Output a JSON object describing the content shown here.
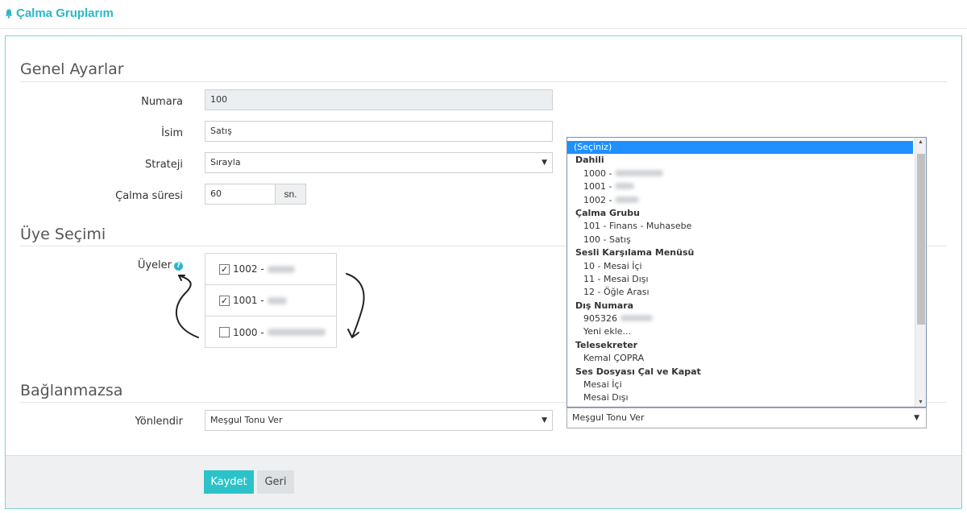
{
  "page": {
    "title": "Çalma Gruplarım"
  },
  "sections": {
    "general": "Genel Ayarlar",
    "members": "Üye Seçimi",
    "no_answer": "Bağlanmazsa"
  },
  "form": {
    "number_label": "Numara",
    "number_value": "100",
    "name_label": "İsim",
    "name_value": "Satış",
    "strategy_label": "Strateji",
    "strategy_value": "Sırayla",
    "ring_time_label": "Çalma süresi",
    "ring_time_value": "60",
    "ring_time_unit": "sn.",
    "members_label": "Üyeler",
    "help_icon": "?",
    "redirect_label": "Yönlendir",
    "redirect_value": "Meşgul Tonu Ver"
  },
  "members": [
    {
      "prefix": "1002 -",
      "checked": true
    },
    {
      "prefix": "1001 -",
      "checked": true
    },
    {
      "prefix": "1000 -",
      "checked": false
    }
  ],
  "check_mark": "✓",
  "dropdown": {
    "items": [
      {
        "type": "sel",
        "text": "(Seçiniz)"
      },
      {
        "type": "group",
        "text": "Dahili"
      },
      {
        "type": "opt",
        "text": "1000 -"
      },
      {
        "type": "opt",
        "text": "1001 -"
      },
      {
        "type": "opt",
        "text": "1002 -"
      },
      {
        "type": "group",
        "text": "Çalma Grubu"
      },
      {
        "type": "opt",
        "text": "101 - Finans - Muhasebe"
      },
      {
        "type": "opt",
        "text": "100 - Satış"
      },
      {
        "type": "group",
        "text": "Sesli Karşılama Menüsü"
      },
      {
        "type": "opt",
        "text": "10 - Mesai İçi"
      },
      {
        "type": "opt",
        "text": "11 - Mesai Dışı"
      },
      {
        "type": "opt",
        "text": "12 - Öğle Arası"
      },
      {
        "type": "group",
        "text": "Dış Numara"
      },
      {
        "type": "opt",
        "text": "905326"
      },
      {
        "type": "opt",
        "text": "Yeni ekle..."
      },
      {
        "type": "group",
        "text": "Telesekreter"
      },
      {
        "type": "opt",
        "text": "Kemal ÇOPRA"
      },
      {
        "type": "group",
        "text": "Ses Dosyası Çal ve Kapat"
      },
      {
        "type": "opt",
        "text": "Mesai İçi"
      },
      {
        "type": "opt",
        "text": "Mesai Dışı"
      }
    ],
    "selected_value": "Meşgul Tonu Ver"
  },
  "buttons": {
    "save": "Kaydet",
    "back": "Geri"
  },
  "colors": {
    "accent": "#2bb8c8",
    "primary_button": "#2bc3c9",
    "dropdown_highlight": "#1e90ff"
  }
}
